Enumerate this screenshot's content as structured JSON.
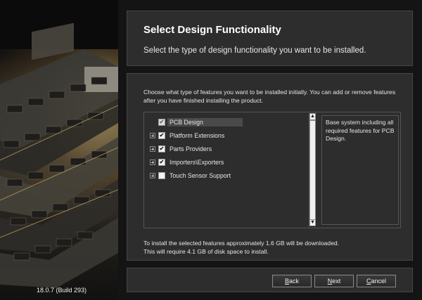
{
  "version": "18.0.7 (Build 293)",
  "header": {
    "title": "Select Design Functionality",
    "subtitle": "Select the type of design functionality you want to be installed."
  },
  "intro_text": "Choose what type of features you want to be installed initially. You can add or remove features after you have finished installing the product.",
  "features": [
    {
      "label": "PCB Design",
      "checked": true,
      "grayed": true,
      "expandable": false,
      "selected": true
    },
    {
      "label": "Platform Extensions",
      "checked": true,
      "expandable": true
    },
    {
      "label": "Parts Providers",
      "checked": true,
      "expandable": true
    },
    {
      "label": "Importers\\Exporters",
      "checked": true,
      "expandable": true
    },
    {
      "label": "Touch Sensor Support",
      "checked": false,
      "expandable": true
    }
  ],
  "description": "Base system including all required features for PCB Design.",
  "download_info": {
    "line1": "To install the selected features approximately 1.6 GB will be downloaded.",
    "line2": "This will require 4.1 GB of disk space to install."
  },
  "buttons": {
    "back": {
      "mnemonic": "B",
      "rest": "ack"
    },
    "next": {
      "mnemonic": "N",
      "rest": "ext"
    },
    "cancel": {
      "mnemonic": "C",
      "rest": "ancel"
    }
  },
  "icons": {
    "checkmark": "✔",
    "scroll_up": "▲",
    "scroll_down": "▼"
  }
}
